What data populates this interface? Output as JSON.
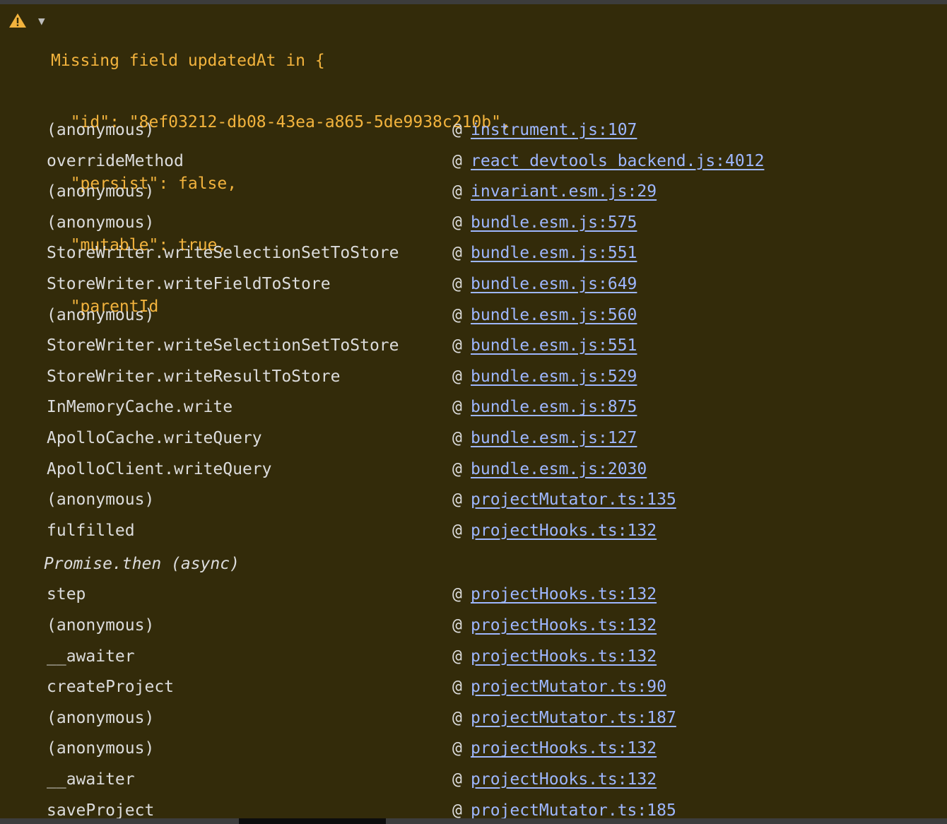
{
  "warning": {
    "icon": "warning-triangle-icon",
    "disclosure_glyph": "▼",
    "lines": [
      "Missing field updatedAt in {",
      "  \"id\": \"8ef03212-db08-43ea-a865-5de9938c210b\",",
      "  \"persist\": false,",
      "  \"mutable\": true,",
      "  \"parentId"
    ],
    "colors": {
      "text": "#f2b33d",
      "background": "#332b0a",
      "link": "#9eb7ff"
    }
  },
  "stack": {
    "at_symbol": "@",
    "frames": [
      {
        "fn": "(anonymous)",
        "loc": "instrument.js:107"
      },
      {
        "fn": "overrideMethod",
        "loc": "react_devtools_backend.js:4012"
      },
      {
        "fn": "(anonymous)",
        "loc": "invariant.esm.js:29"
      },
      {
        "fn": "(anonymous)",
        "loc": "bundle.esm.js:575"
      },
      {
        "fn": "StoreWriter.writeSelectionSetToStore",
        "loc": "bundle.esm.js:551"
      },
      {
        "fn": "StoreWriter.writeFieldToStore",
        "loc": "bundle.esm.js:649"
      },
      {
        "fn": "(anonymous)",
        "loc": "bundle.esm.js:560"
      },
      {
        "fn": "StoreWriter.writeSelectionSetToStore",
        "loc": "bundle.esm.js:551"
      },
      {
        "fn": "StoreWriter.writeResultToStore",
        "loc": "bundle.esm.js:529"
      },
      {
        "fn": "InMemoryCache.write",
        "loc": "bundle.esm.js:875"
      },
      {
        "fn": "ApolloCache.writeQuery",
        "loc": "bundle.esm.js:127"
      },
      {
        "fn": "ApolloClient.writeQuery",
        "loc": "bundle.esm.js:2030"
      },
      {
        "fn": "(anonymous)",
        "loc": "projectMutator.ts:135"
      },
      {
        "fn": "fulfilled",
        "loc": "projectHooks.ts:132"
      }
    ],
    "async_label": "Promise.then (async)",
    "async_frames": [
      {
        "fn": "step",
        "loc": "projectHooks.ts:132"
      },
      {
        "fn": "(anonymous)",
        "loc": "projectHooks.ts:132"
      },
      {
        "fn": "__awaiter",
        "loc": "projectHooks.ts:132"
      },
      {
        "fn": "createProject",
        "loc": "projectMutator.ts:90"
      },
      {
        "fn": "(anonymous)",
        "loc": "projectMutator.ts:187"
      },
      {
        "fn": "(anonymous)",
        "loc": "projectHooks.ts:132"
      },
      {
        "fn": "__awaiter",
        "loc": "projectHooks.ts:132"
      },
      {
        "fn": "saveProject",
        "loc": "projectMutator.ts:185"
      }
    ]
  }
}
